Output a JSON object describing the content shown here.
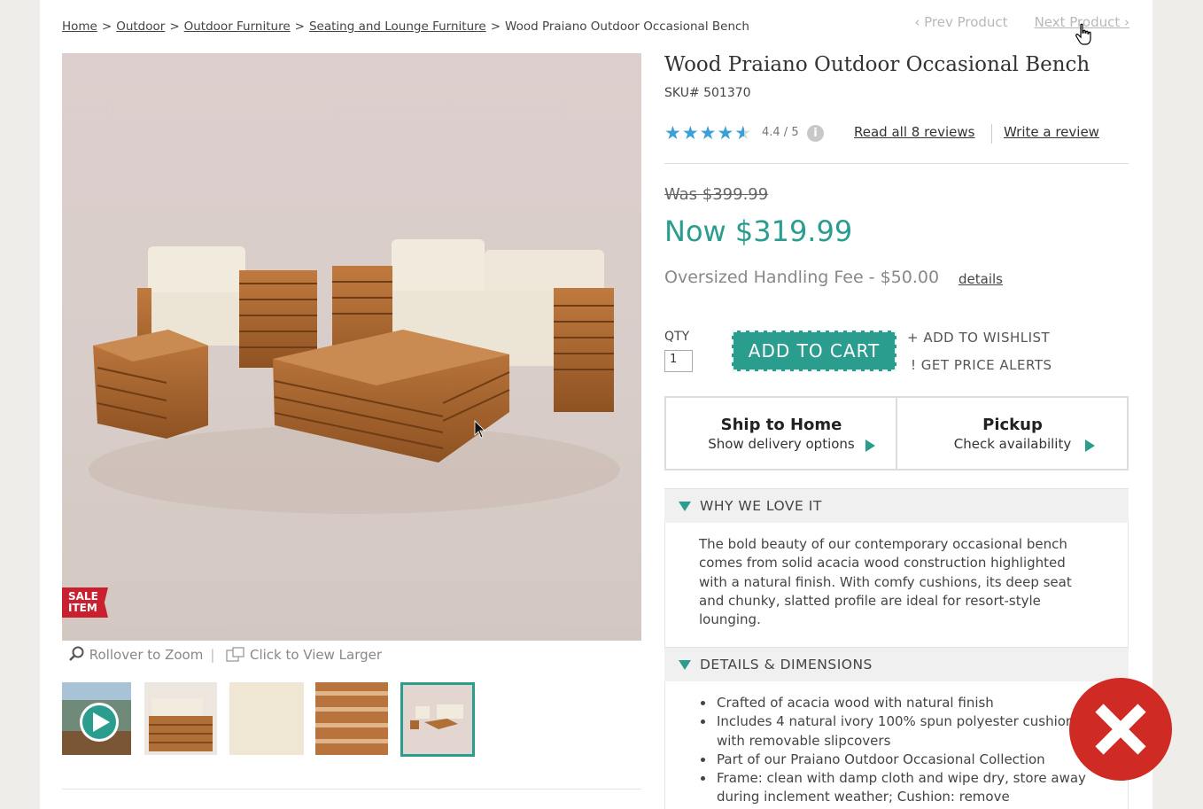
{
  "breadcrumb": {
    "home": "Home",
    "outdoor": "Outdoor",
    "outdoor_furniture": "Outdoor Furniture",
    "seating": "Seating and Lounge Furniture",
    "current": "Wood Praiano Outdoor Occasional Bench",
    "separator": ">"
  },
  "product_nav": {
    "prev": "‹ Prev Product",
    "next": "Next Product ›"
  },
  "product": {
    "title": "Wood Praiano Outdoor Occasional Bench",
    "sku": "SKU#  501370",
    "rating": "4.4 / 5",
    "rating_value": 4.4,
    "read_reviews": "Read all 8 reviews",
    "write_review": "Write a review",
    "was_price": "Was $399.99",
    "now_price": "Now $319.99",
    "fee": "Oversized Handling Fee - $50.00",
    "fee_details": "details",
    "sale_badge": "SALE ITEM"
  },
  "gallery": {
    "zoom_label": "Rollover to Zoom",
    "larger_label": "Click to View Larger",
    "thumbnails": [
      "video",
      "bench-side",
      "cushion-swatch",
      "wood-swatch",
      "set-overview"
    ],
    "selected_thumbnail": 4
  },
  "purchase": {
    "qty_label": "QTY",
    "qty_value": "1",
    "add_to_cart": "ADD TO CART",
    "add_to_wishlist": "+ ADD TO WISHLIST",
    "price_alerts": "! GET PRICE ALERTS"
  },
  "fulfillment": {
    "ship_title": "Ship to Home",
    "ship_sub": "Show delivery options",
    "pickup_title": "Pickup",
    "pickup_sub": "Check availability"
  },
  "accordion": {
    "why_title": "WHY WE LOVE IT",
    "why_text": "The bold beauty of our contemporary occasional bench comes from solid acacia wood construction highlighted with a natural finish. With comfy cushions, its deep seat and chunky, slatted profile are ideal for resort-style lounging.",
    "details_title": "DETAILS & DIMENSIONS",
    "details": [
      "Crafted of acacia wood with natural finish",
      "Includes 4 natural ivory 100% spun polyester cushion with removable slipcovers",
      "Part of our Praiano Outdoor Occasional Collection",
      "Frame: clean with damp cloth and wipe dry, store away during inclement weather; Cushion: remove"
    ]
  },
  "colors": {
    "accent": "#2a9d8f",
    "star": "#3b9fd8",
    "sale": "#c8202f",
    "close": "#cf2b24"
  },
  "icons": [
    "magnifier-icon",
    "enlarge-icon",
    "info-icon",
    "play-icon",
    "close-icon",
    "hand-cursor-icon",
    "arrow-cursor-icon"
  ]
}
